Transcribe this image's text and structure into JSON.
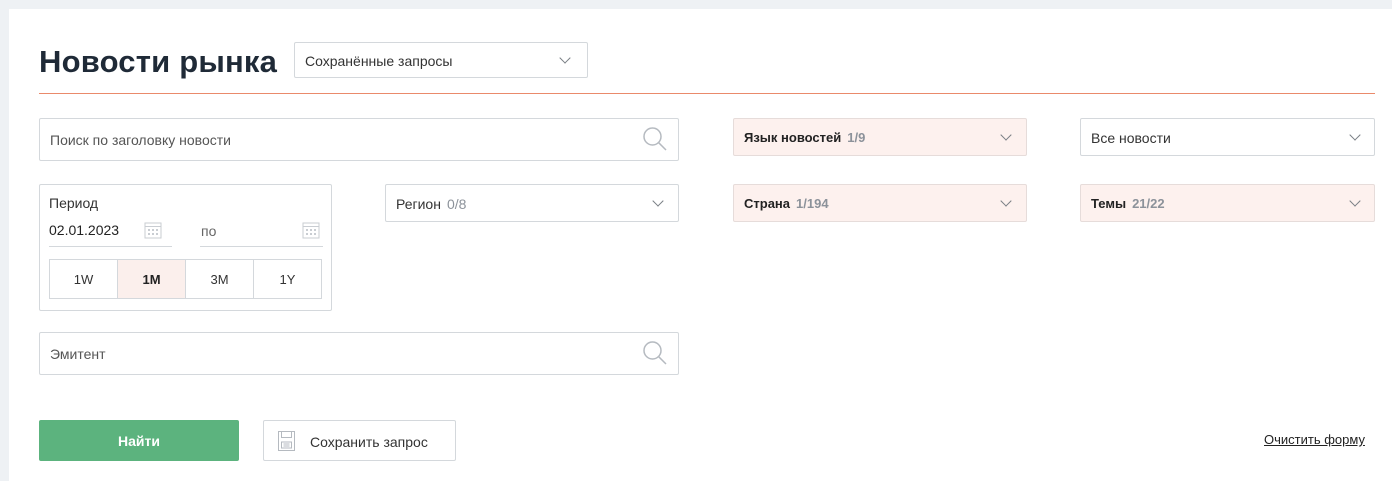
{
  "header": {
    "title": "Новости рынка",
    "saved_queries": {
      "label": "Сохранённые запросы"
    },
    "divider_color": "#ea8a6b"
  },
  "search": {
    "headline_placeholder": "Поиск по заголовку новости",
    "issuer_placeholder": "Эмитент"
  },
  "period": {
    "label": "Период",
    "from_date": "02.01.2023",
    "to_label": "по",
    "to_date": "",
    "buttons": [
      "1W",
      "1M",
      "3M",
      "1Y"
    ],
    "active": "1M"
  },
  "filters": {
    "region": {
      "label": "Регион",
      "count": "0/8"
    },
    "language": {
      "label": "Язык новостей",
      "count": "1/9"
    },
    "news_type": {
      "label": "Все новости"
    },
    "country": {
      "label": "Страна",
      "count": "1/194"
    },
    "topics": {
      "label": "Темы",
      "count": "21/22"
    }
  },
  "actions": {
    "find": "Найти",
    "save_query": "Сохранить запрос",
    "clear_form": "Очистить форму"
  },
  "colors": {
    "accent_green": "#5cb37e",
    "highlight_pink": "#fdf1ee"
  }
}
